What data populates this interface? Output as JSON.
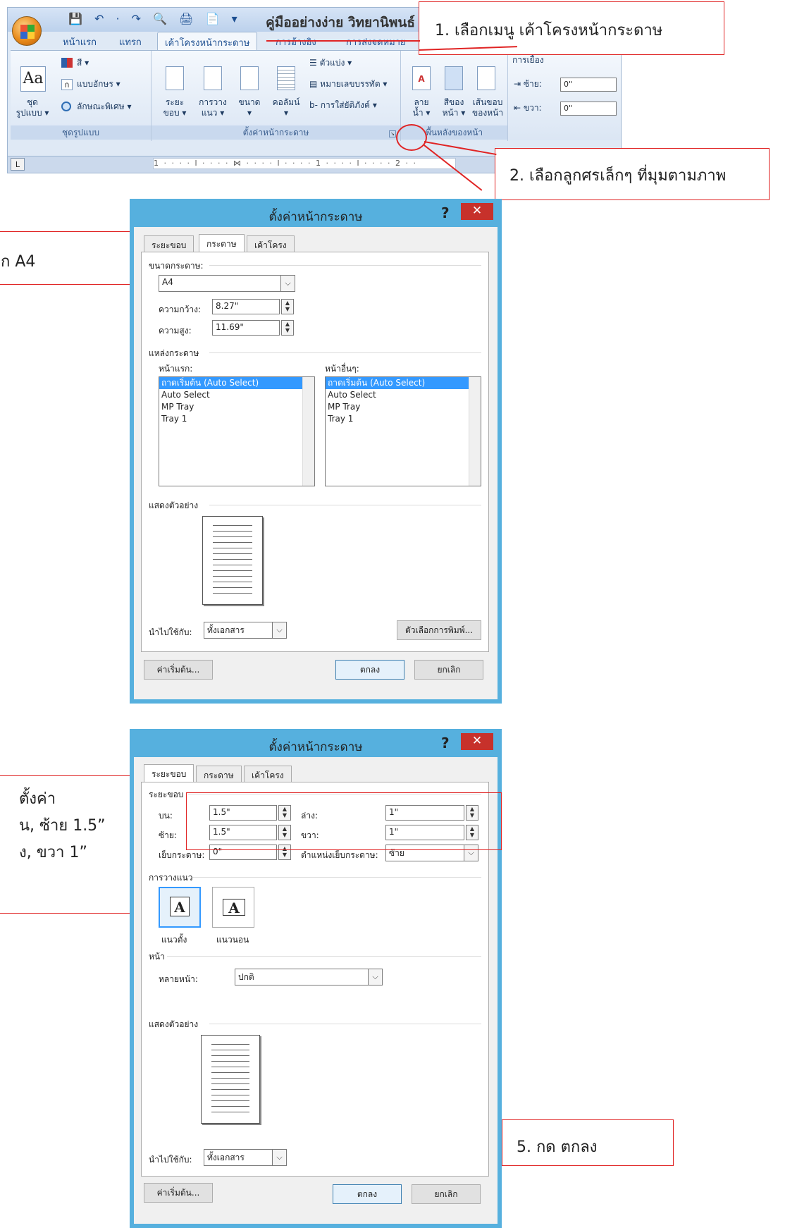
{
  "ribbon": {
    "qat_icons": "💾 ↶ · ↷ 🔍 🖨 📄 ▾",
    "window_title": "คู่มืออย่างง่าย วิทยานิพนธ์",
    "tabs": [
      "หน้าแรก",
      "แทรก",
      "เค้าโครงหน้ากระดาษ",
      "การอ้างอิง",
      "การส่งจดหมาย"
    ],
    "active_tab": "เค้าโครงหน้ากระดาษ",
    "themes": {
      "label1": "ชุด",
      "label2": "รูปแบบ ▾",
      "colors": "สี ▾",
      "fonts": "แบบอักษร ▾",
      "effects": "ลักษณะพิเศษ ▾",
      "group": "ชุดรูปแบบ"
    },
    "page_setup": {
      "margins1": "ระยะ",
      "margins2": "ขอบ ▾",
      "orientation1": "การวาง",
      "orientation2": "แนว ▾",
      "size1": "ขนาด",
      "size2": "▾",
      "columns1": "คอลัมน์",
      "columns2": "▾",
      "breaks": "ตัวแบ่ง ▾",
      "line_numbers": "หมายเลขบรรทัด ▾",
      "hyphenation": "การใส่ยัติภังค์ ▾",
      "group": "ตั้งค่าหน้ากระดาษ"
    },
    "page_background": {
      "watermark1": "ลาย",
      "watermark2": "น้ำ ▾",
      "color1": "สีของ",
      "color2": "หน้า ▾",
      "borders1": "เส้นขอบ",
      "borders2": "ของหน้า",
      "group": "พื้นหลังของหน้า"
    },
    "indent": {
      "title": "การเยื้อง",
      "left_label": "ซ้าย:",
      "left_value": "0\"",
      "right_label": "ขวา:",
      "right_value": "0\""
    },
    "ruler_text": "1 · · · · l · · · · ⋈ · · · · l · · · · 1 · · · · l · · · · 2 · ·",
    "ruler_tab": "L"
  },
  "callouts": {
    "step1": "1. เลือกเมนู เค้าโครงหน้ากระดาษ",
    "step2": "2. เลือกลูกศรเล็กๆ ที่มุมตามภาพ",
    "step3": "ก A4",
    "step4_line1": "ตั้งค่า",
    "step4_line2": "น, ซ้าย 1.5”",
    "step4_line3": "ง, ขวา 1”",
    "step5": "5. กด ตกลง"
  },
  "dialog_paper": {
    "title": "ตั้งค่าหน้ากระดาษ",
    "help": "?",
    "close": "✕",
    "tabs": [
      "ระยะขอบ",
      "กระดาษ",
      "เค้าโครง"
    ],
    "active_tab": "กระดาษ",
    "paper_size_label": "ขนาดกระดาษ:",
    "paper_size_value": "A4",
    "width_label": "ความกว้าง:",
    "width_value": "8.27\"",
    "height_label": "ความสูง:",
    "height_value": "11.69\"",
    "paper_source_label": "แหล่งกระดาษ",
    "first_page_label": "หน้าแรก:",
    "other_pages_label": "หน้าอื่นๆ:",
    "first_page_items": [
      "ถาดเริ่มต้น (Auto Select)",
      "Auto Select",
      "MP Tray",
      "Tray 1"
    ],
    "other_pages_items": [
      "ถาดเริ่มต้น (Auto Select)",
      "Auto Select",
      "MP Tray",
      "Tray 1"
    ],
    "preview_label": "แสดงตัวอย่าง",
    "apply_label": "นำไปใช้กับ:",
    "apply_value": "ทั้งเอกสาร",
    "print_options": "ตัวเลือกการพิมพ์...",
    "default_btn": "ค่าเริ่มต้น...",
    "ok_btn": "ตกลง",
    "cancel_btn": "ยกเลิก"
  },
  "dialog_margins": {
    "title": "ตั้งค่าหน้ากระดาษ",
    "help": "?",
    "close": "✕",
    "tabs": [
      "ระยะขอบ",
      "กระดาษ",
      "เค้าโครง"
    ],
    "active_tab": "ระยะขอบ",
    "margins_label": "ระยะขอบ",
    "top_label": "บน:",
    "top_value": "1.5\"",
    "bottom_label": "ล่าง:",
    "bottom_value": "1\"",
    "left_label": "ซ้าย:",
    "left_value": "1.5\"",
    "right_label": "ขวา:",
    "right_value": "1\"",
    "gutter_label": "เย็บกระดาษ:",
    "gutter_value": "0\"",
    "gutter_pos_label": "ตำแหน่งเย็บกระดาษ:",
    "gutter_pos_value": "ซ้าย",
    "orientation_label": "การวางแนว",
    "portrait": "แนวตั้ง",
    "landscape": "แนวนอน",
    "pages_label": "หน้า",
    "multiple_pages_label": "หลายหน้า:",
    "multiple_pages_value": "ปกติ",
    "preview_label": "แสดงตัวอย่าง",
    "apply_label": "นำไปใช้กับ:",
    "apply_value": "ทั้งเอกสาร",
    "default_btn": "ค่าเริ่มต้น...",
    "ok_btn": "ตกลง",
    "cancel_btn": "ยกเลิก"
  }
}
